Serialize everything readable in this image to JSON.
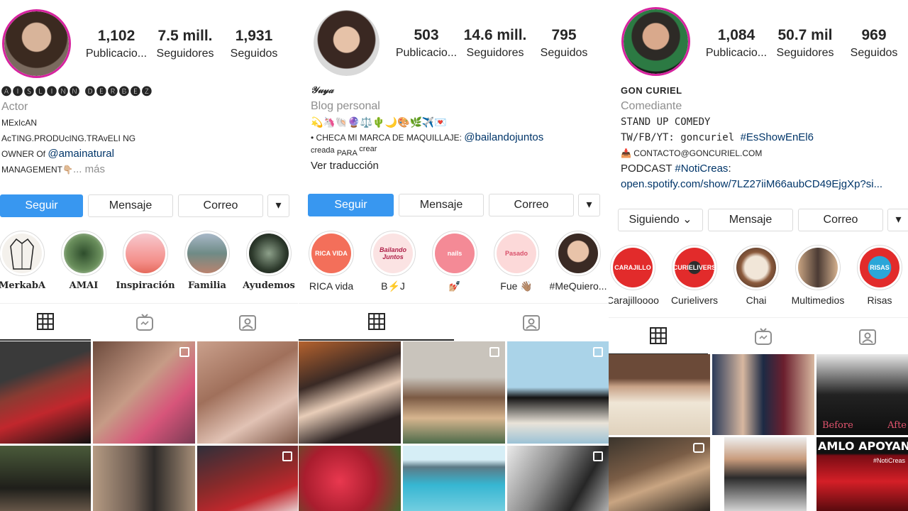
{
  "profiles": [
    {
      "stats": [
        {
          "num": "1,102",
          "label": "Publicacio..."
        },
        {
          "num": "7.5 mill.",
          "label": "Seguidores"
        },
        {
          "num": "1,931",
          "label": "Seguidos"
        }
      ],
      "name": "🅐🅘🅢🅛🅘🅝🅝   🅓🅔🅡🅑🅔🅩",
      "category": "Actor",
      "bio_lines": [
        "MExIcAN",
        "AcTING.PRODUcING.TRAvELI NG"
      ],
      "owner_prefix": "OWNER Of ",
      "owner_link": "@amainatural",
      "management": "MANAGEMENT👇🏼",
      "more": "... más",
      "buttons": {
        "primary": "Seguir",
        "message": "Mensaje",
        "email": "Correo",
        "dropdown": "▾"
      },
      "highlights": [
        "MerkabA",
        "AMAI",
        "Inspiración",
        "Familia",
        "Ayudemos"
      ]
    },
    {
      "stats": [
        {
          "num": "503",
          "label": "Publicacio..."
        },
        {
          "num": "14.6 mill.",
          "label": "Seguidores"
        },
        {
          "num": "795",
          "label": "Seguidos"
        }
      ],
      "name": "𝒴𝓊𝓎𝒶",
      "category": "Blog personal",
      "emoji_line": "💫🦄🐚🔮⚖️🌵🌙🎨🌿✈️💌",
      "bio_prefix": "• CHECA MI MARCA DE MAQUILLAJE: ",
      "bio_link": "@bailandojuntos",
      "sub_line_a": "creada ",
      "sub_line_b": "PARA",
      "sub_line_c": " crear",
      "translate": "Ver traducción",
      "buttons": {
        "primary": "Seguir",
        "message": "Mensaje",
        "email": "Correo",
        "dropdown": "▾"
      },
      "highlights": [
        "RICA vida",
        "B⚡J",
        "💅🏼",
        "Fue 👋🏽",
        "#MeQuiero..."
      ],
      "highlight_texts": [
        "RICA VIDA",
        "Bailando Juntos",
        "nails",
        "Pasado",
        ""
      ]
    },
    {
      "stats": [
        {
          "num": "1,084",
          "label": "Publicacio..."
        },
        {
          "num": "50.7 mil",
          "label": "Seguidores"
        },
        {
          "num": "969",
          "label": "Seguidos"
        }
      ],
      "name": "GON CURIEL",
      "category": "Comediante",
      "line1": "STAND UP COMEDY",
      "line2_prefix": "TW/FB/YT: goncuriel ",
      "line2_link": "#EsShowEnEl6",
      "contact": "📥 CONTACTO@GONCURIEL.COM",
      "podcast_prefix": "PODCAST ",
      "podcast_link": "#NotiCreas",
      "podcast_suffix": ":",
      "url": "open.spotify.com/show/7LZ27iiM66aubCD49EjgXp?si...",
      "buttons": {
        "primary": "Siguiendo ⌄",
        "message": "Mensaje",
        "email": "Correo",
        "dropdown": "▾"
      },
      "highlights": [
        "Carajilloooo",
        "Curielivers",
        "Chai",
        "Multimedios",
        "Risas"
      ],
      "highlight_texts": [
        "CARAJILLO",
        "CURIELIVERS",
        "",
        "",
        "RISAS"
      ],
      "tile_texts": {
        "before": "Before",
        "after": "Afte",
        "amlo": "AMLO APOYANDO",
        "noti": "#NotiCreas"
      }
    }
  ],
  "colors": {
    "accent": "#3897f0",
    "link": "#003569",
    "muted": "#8e8e8e",
    "border": "#dbdbdb",
    "ring": "#d6249f"
  },
  "icons": [
    "grid-icon",
    "igtv-icon",
    "tagged-icon"
  ]
}
